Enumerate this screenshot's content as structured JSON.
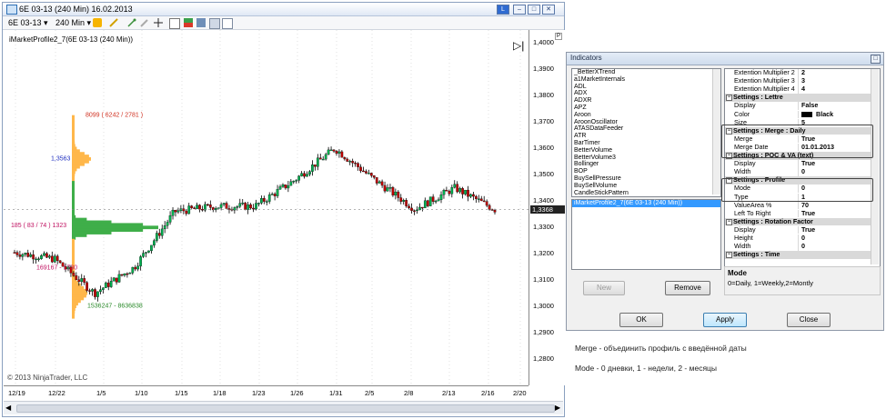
{
  "chart_window": {
    "title": "6E 03-13 (240 Min)  16.02.2013",
    "instrument": "6E 03-13",
    "interval": "240 Min",
    "indicator_label": "iMarketProfile2_7(6E 03-13 (240 Min))",
    "copyright": "© 2013 NinjaTrader, LLC",
    "panel_number": "P",
    "current_price": "1,3368",
    "price_ticks": [
      "1,4000",
      "1,3900",
      "1,3800",
      "1,3700",
      "1,3600",
      "1,3500",
      "1,3400",
      "1,3300",
      "1,3200",
      "1,3100",
      "1,3000",
      "1,2900",
      "1,2800"
    ],
    "date_ticks": [
      "12/19",
      "12/22",
      "1/5",
      "1/10",
      "1/15",
      "1/18",
      "1/23",
      "1/26",
      "1/31",
      "2/5",
      "2/8",
      "2/13",
      "2/16",
      "2/20"
    ],
    "profile_labels": {
      "top": "8099 ( 6242 / 2781 )",
      "poc": "1,3563",
      "bottom": "1536247 - 8636838",
      "left_a": "185 ( 83 / 74 ) 1323",
      "left_b": "169167 - 1730"
    },
    "colors": {
      "up": "#00b050",
      "down": "#c00000",
      "profile_va": "#3fae49",
      "profile_out": "#ffb74a",
      "wick": "#000000"
    }
  },
  "chart_data": {
    "type": "candlestick",
    "x": [
      "12/19",
      "12/22",
      "1/5",
      "1/10",
      "1/15",
      "1/18",
      "1/23",
      "1/26",
      "1/31",
      "2/5",
      "2/8",
      "2/13",
      "2/16"
    ],
    "close": [
      1.3205,
      1.318,
      1.305,
      1.315,
      1.336,
      1.338,
      1.338,
      1.348,
      1.36,
      1.348,
      1.337,
      1.345,
      1.3368
    ],
    "ylim": [
      1.27,
      1.405
    ]
  },
  "dialog": {
    "title": "Indicators",
    "indicators": [
      "_BetterXTrend",
      "a1MarketInternals",
      "ADL",
      "ADX",
      "ADXR",
      "APZ",
      "Aroon",
      "AroonOscillator",
      "ATASDataFeeder",
      "ATR",
      "BarTimer",
      "BetterVolume",
      "BetterVolume3",
      "Bollinger",
      "BOP",
      "BuySellPressure",
      "BuySellVolume",
      "CandleStickPattern"
    ],
    "applied": "iMarketProfile2_7(6E 03-13 (240 Min))",
    "new_label": "New",
    "remove_label": "Remove",
    "ok_label": "OK",
    "apply_label": "Apply",
    "close_label": "Close",
    "description_title": "Mode",
    "description_text": "0=Daily, 1=Weekly,2=Montly",
    "properties": [
      {
        "cat": false,
        "k": "Extention Multiplier 2",
        "v": "2"
      },
      {
        "cat": false,
        "k": "Extention Multiplier 3",
        "v": "3"
      },
      {
        "cat": false,
        "k": "Extention Multiplier 4",
        "v": "4"
      },
      {
        "cat": true,
        "k": "Settings : Lettre"
      },
      {
        "cat": false,
        "k": "Display",
        "v": "False"
      },
      {
        "cat": false,
        "k": "Color",
        "v": "Black",
        "swatch": "#000000"
      },
      {
        "cat": false,
        "k": "Size",
        "v": "5"
      },
      {
        "cat": true,
        "k": "Settings : Merge : Daily"
      },
      {
        "cat": false,
        "k": "Merge",
        "v": "True"
      },
      {
        "cat": false,
        "k": "Merge Date",
        "v": "01.01.2013"
      },
      {
        "cat": true,
        "k": "Settings : POC & VA (text)"
      },
      {
        "cat": false,
        "k": "Display",
        "v": "True"
      },
      {
        "cat": false,
        "k": "Width",
        "v": "0"
      },
      {
        "cat": true,
        "k": "Settings : Profile"
      },
      {
        "cat": false,
        "k": "Mode",
        "v": "0"
      },
      {
        "cat": false,
        "k": "Type",
        "v": "1"
      },
      {
        "cat": false,
        "k": "ValueArea %",
        "v": "70"
      },
      {
        "cat": false,
        "k": "Left To Right",
        "v": "True"
      },
      {
        "cat": true,
        "k": "Settings : Rotation Factor"
      },
      {
        "cat": false,
        "k": "Display",
        "v": "True"
      },
      {
        "cat": false,
        "k": "Height",
        "v": "0"
      },
      {
        "cat": false,
        "k": "Width",
        "v": "0"
      },
      {
        "cat": true,
        "k": "Settings : Time"
      }
    ]
  },
  "notes": {
    "line1": "Merge - объединить профиль с введённой даты",
    "line2": "Mode - 0 дневки, 1 - недели, 2 - месяцы"
  }
}
